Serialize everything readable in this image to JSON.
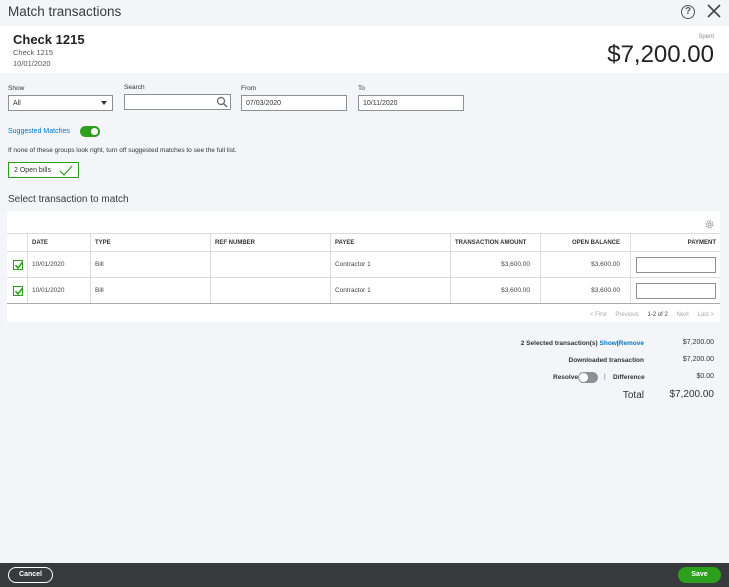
{
  "window": {
    "title": "Match transactions"
  },
  "header": {
    "check_title": "Check 1215",
    "check_sub": "Check 1215",
    "check_date": "10/01/2020",
    "spent_label": "Spent",
    "spent_amount": "$7,200.00"
  },
  "filters": {
    "show_label": "Show",
    "show_value": "All",
    "search_label": "Search",
    "search_value": "",
    "from_label": "From",
    "from_value": "07/03/2020",
    "to_label": "To",
    "to_value": "10/11/2020"
  },
  "suggested": {
    "label": "Suggested Matches",
    "enabled": true,
    "hint": "If none of these groups look right, turn off suggested matches to see the full list.",
    "group_button": "2 Open bills"
  },
  "section_title": "Select transaction to match",
  "table": {
    "columns": [
      "DATE",
      "TYPE",
      "REF NUMBER",
      "PAYEE",
      "TRANSACTION AMOUNT",
      "OPEN BALANCE",
      "PAYMENT"
    ],
    "rows": [
      {
        "checked": true,
        "date": "10/01/2020",
        "type": "Bill",
        "ref": "",
        "payee": "Contractor 1",
        "amount": "$3,600.00",
        "balance": "$3,600.00",
        "payment": ""
      },
      {
        "checked": true,
        "date": "10/01/2020",
        "type": "Bill",
        "ref": "",
        "payee": "Contractor 1",
        "amount": "$3,600.00",
        "balance": "$3,600.00",
        "payment": ""
      }
    ]
  },
  "pager": {
    "first": "< First",
    "previous": "Previous",
    "current": "1-2 of 2",
    "next": "Next",
    "last": "Last >"
  },
  "summary": {
    "selected_text": "2 Selected transaction(s)",
    "show_link": "Show",
    "separator": "|",
    "remove_link": "Remove",
    "selected_value": "$7,200.00",
    "downloaded_label": "Downloaded transaction",
    "downloaded_value": "$7,200.00",
    "resolve_label": "Resolve",
    "resolve_sep": "|",
    "difference_label": "Difference",
    "difference_value": "$0.00",
    "total_label": "Total",
    "total_value": "$7,200.00"
  },
  "footer": {
    "cancel_label": "Cancel",
    "save_label": "Save"
  },
  "colors": {
    "accent_green": "#2ca01c",
    "link_blue": "#0077c5",
    "footer_bg": "#393a3d"
  },
  "icons": [
    "help-icon",
    "close-icon",
    "search-icon",
    "checkmark-icon",
    "gear-icon"
  ]
}
